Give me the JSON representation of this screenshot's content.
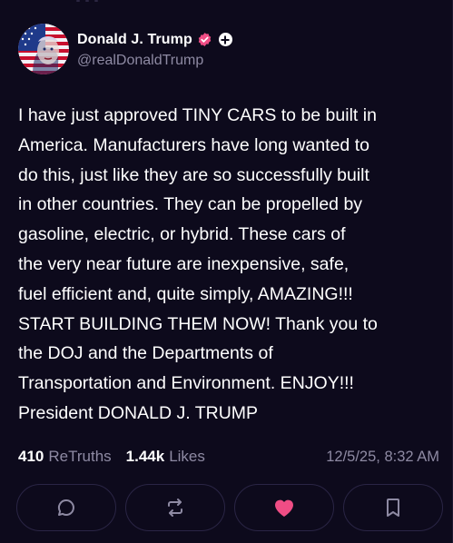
{
  "author": {
    "display_name": "Donald J. Trump",
    "handle": "@realDonaldTrump",
    "avatar_icon": "flag-portrait-avatar",
    "verified_color": "#ef4d85"
  },
  "post": {
    "text": "I have just approved TINY CARS to be built in\nAmerica. Manufacturers have long wanted to\ndo this, just like they are so successfully built\nin other countries. They can be propelled by\ngasoline, electric, or hybrid. These cars of\nthe very near future are inexpensive, safe,\nfuel efficient and, quite simply, AMAZING!!!\nSTART BUILDING THEM NOW! Thank you to\nthe DOJ and the Departments of\nTransportation and Environment. ENJOY!!!\nPresident DONALD J. TRUMP"
  },
  "stats": {
    "retruths_count": "410",
    "retruths_label": "ReTruths",
    "likes_count": "1.44k",
    "likes_label": "Likes",
    "timestamp": "12/5/25, 8:32 AM"
  },
  "actions": [
    {
      "icon": "reply-icon"
    },
    {
      "icon": "retruth-icon"
    },
    {
      "icon": "heart-icon",
      "active_color": "#ef4d85"
    },
    {
      "icon": "bookmark-icon"
    }
  ]
}
